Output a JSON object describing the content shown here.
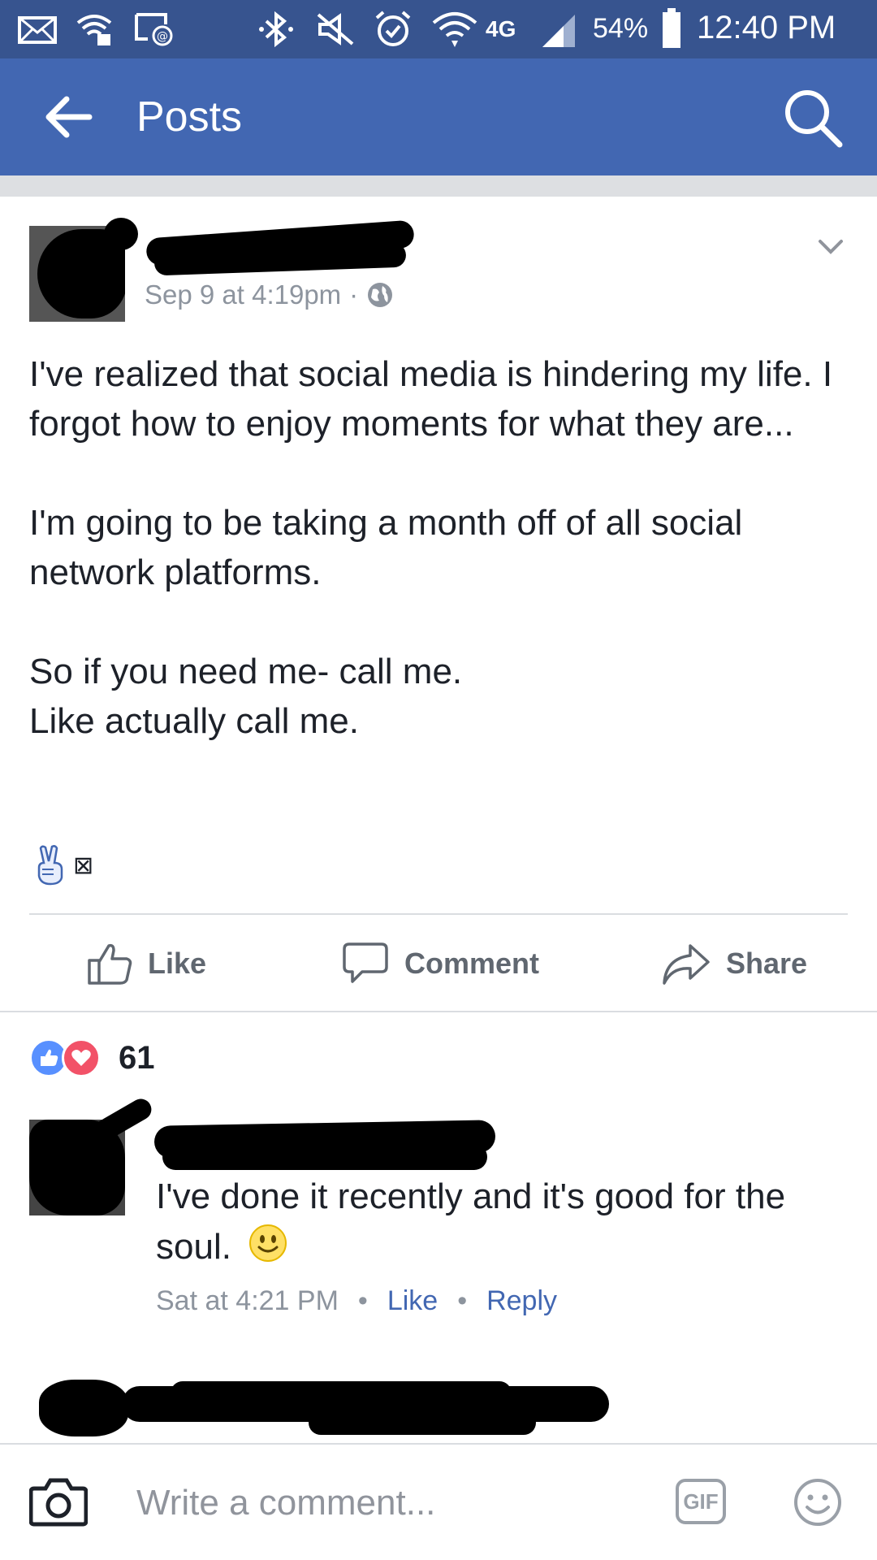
{
  "status_bar": {
    "network": "4G",
    "battery": "54%",
    "time": "12:40 PM",
    "icons": [
      "mail-icon",
      "wifi-call-icon",
      "screen-mirror-icon",
      "bluetooth-icon",
      "mute-icon",
      "alarm-icon",
      "wifi-icon",
      "signal-icon",
      "battery-icon"
    ]
  },
  "header": {
    "title": "Posts",
    "back_icon": "back-arrow-icon",
    "search_icon": "search-icon"
  },
  "post": {
    "author": "",
    "timestamp": "Sep 9 at 4:19pm",
    "separator": "·",
    "privacy_icon": "globe-icon",
    "paragraphs": [
      "I've realized that social media is hindering my life. I forgot how to enjoy moments for what they are...",
      "I'm going to be taking a month off of all social network platforms.",
      "So if you need me- call me.",
      "Like actually call me."
    ],
    "emoji": "✌",
    "emoji_box": "⊠",
    "actions": {
      "like": "Like",
      "comment": "Comment",
      "share": "Share"
    },
    "reactions": {
      "types": [
        "like",
        "love"
      ],
      "count": "61"
    }
  },
  "comment": {
    "author": "",
    "text": "I've done it recently and it's good for the soul.",
    "timestamp": "Sat at 4:21 PM",
    "like": "Like",
    "reply": "Reply",
    "separator": "•"
  },
  "composer": {
    "placeholder": "Write a comment...",
    "gif_label": "GIF"
  },
  "colors": {
    "status_bar": "#37548f",
    "header": "#4267b2",
    "link": "#4267b2",
    "meta": "#8d949e",
    "like_reaction": "#5890ff",
    "love_reaction": "#f25268"
  }
}
